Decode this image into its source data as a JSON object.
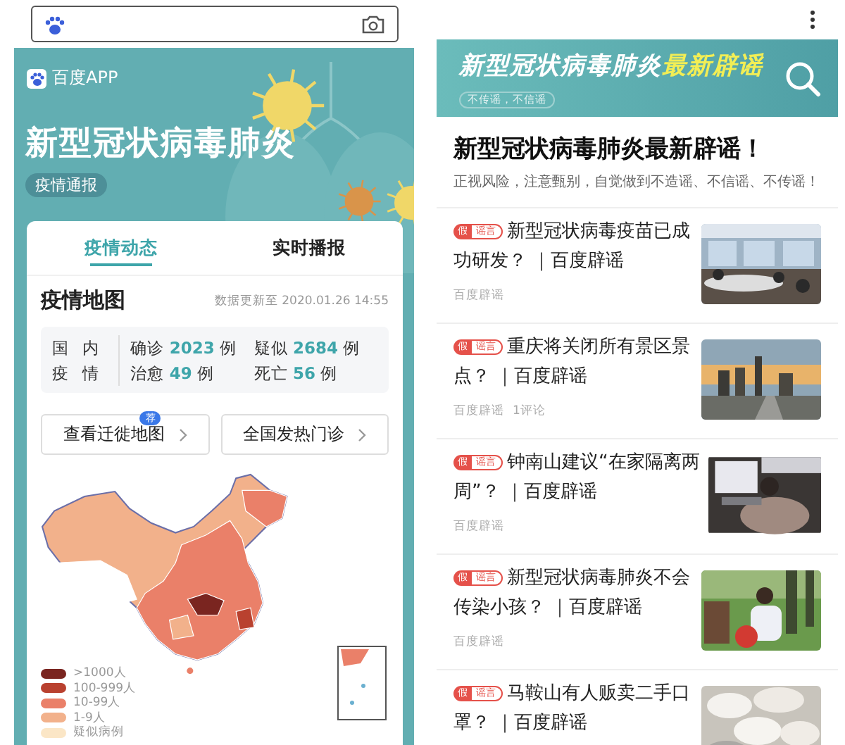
{
  "epidemic_page": {
    "brand": "百度APP",
    "title": "新型冠状病毒肺炎",
    "tag": "疫情通报",
    "tabs": [
      {
        "label": "疫情动态",
        "selected": true
      },
      {
        "label": "实时播报",
        "selected": false
      }
    ],
    "section_title": "疫情地图",
    "updated": "数据更新至 2020.01.26 14:55",
    "region_label": [
      "国 内",
      "疫 情"
    ],
    "stats": [
      {
        "label": "确诊",
        "value": "2023",
        "unit": "例"
      },
      {
        "label": "疑似",
        "value": "2684",
        "unit": "例"
      },
      {
        "label": "治愈",
        "value": "49",
        "unit": "例"
      },
      {
        "label": "死亡",
        "value": "56",
        "unit": "例"
      }
    ],
    "buttons": [
      {
        "label": "查看迁徙地图",
        "badge": "荐"
      },
      {
        "label": "全国发热门诊"
      }
    ],
    "legend": [
      {
        "label": ">1000人",
        "color": "#7a2520"
      },
      {
        "label": "100-999人",
        "color": "#b9412f"
      },
      {
        "label": "10-99人",
        "color": "#ea8069"
      },
      {
        "label": "1-9人",
        "color": "#f2b18b"
      },
      {
        "label": "疑似病例",
        "color": "#fbe6c6"
      }
    ]
  },
  "rumor_page": {
    "banner": {
      "title": "新型冠状病毒肺炎",
      "highlight": "最新辟谣",
      "slogan": "不传谣，不信谣"
    },
    "headline": "新型冠状病毒肺炎最新辟谣！",
    "subtitle": "正视风险，注意甄别，自觉做到不造谣、不信谣、不传谣！",
    "articles": [
      {
        "badge": "假",
        "badge_label": "谣言",
        "title_lines": [
          "新型冠状病毒疫苗已成",
          "功研发？ ｜百度辟谣"
        ],
        "source": "百度辟谣",
        "kind": "picture"
      },
      {
        "badge": "假",
        "badge_label": "谣言",
        "title_lines": [
          "重庆将关闭所有景区景",
          "点？ ｜百度辟谣"
        ],
        "source": "百度辟谣",
        "comments": "1评论",
        "kind": "picture"
      },
      {
        "badge": "假",
        "badge_label": "谣言",
        "title_lines": [
          "钟南山建议“在家隔离两",
          "周”？ ｜百度辟谣"
        ],
        "source": "百度辟谣",
        "kind": "picture"
      },
      {
        "badge": "假",
        "badge_label": "谣言",
        "title_lines": [
          "新型冠状病毒肺炎不会",
          "传染小孩？ ｜百度辟谣"
        ],
        "source": "百度辟谣",
        "kind": "picture"
      },
      {
        "badge": "假",
        "badge_label": "谣言",
        "title_lines": [
          "马鞍山有人贩卖二手口",
          "罩？ ｜百度辟谣"
        ],
        "kind": "picture"
      }
    ]
  }
}
